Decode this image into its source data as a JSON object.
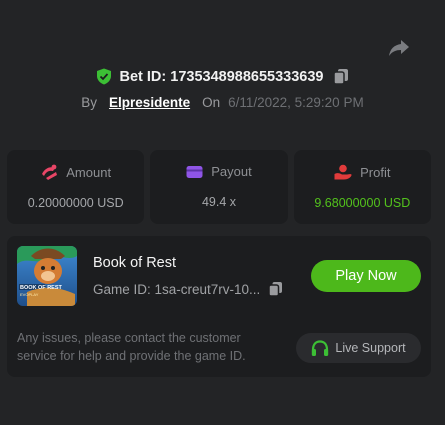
{
  "colors": {
    "background": "#232426",
    "card": "#1c1d1f",
    "accent_green": "#4db81b",
    "profit_green": "#53c21c",
    "amount_icon": "#e84566",
    "payout_icon": "#8f55e6",
    "profit_icon": "#e13b3b"
  },
  "header": {
    "share_icon": "share-arrow-icon",
    "bet_id_label": "Bet ID: 1735348988655333639",
    "by_label": "By",
    "username": "Elpresidente",
    "on_label": "On",
    "datetime": "6/11/2022, 5:29:20 PM"
  },
  "stats": {
    "amount": {
      "label": "Amount",
      "value": "0.20000000 USD",
      "icon": "coins-icon"
    },
    "payout": {
      "label": "Payout",
      "value": "49.4 x",
      "icon": "wallet-icon"
    },
    "profit": {
      "label": "Profit",
      "value": "9.68000000 USD",
      "icon": "profit-hand-icon"
    }
  },
  "game": {
    "thumb_text": "BOOK OF REST",
    "thumb_sub": "EVOPLAY",
    "title": "Book of Rest",
    "game_id": "Game ID: 1sa-creut7rv-10...",
    "play_label": "Play Now",
    "notice": "Any issues, please contact the customer service for help and provide the game ID.",
    "support_label": "Live Support"
  }
}
